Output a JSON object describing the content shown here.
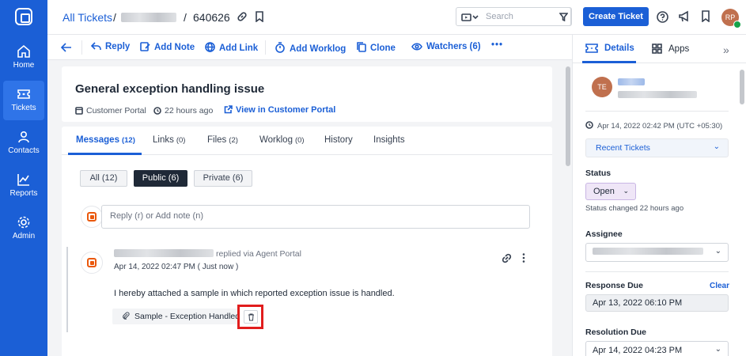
{
  "nav": {
    "items": [
      {
        "label": "Home",
        "icon": "home-icon"
      },
      {
        "label": "Tickets",
        "icon": "ticket-icon",
        "active": true
      },
      {
        "label": "Contacts",
        "icon": "person-icon"
      },
      {
        "label": "Reports",
        "icon": "chart-icon"
      },
      {
        "label": "Admin",
        "icon": "gear-icon"
      }
    ]
  },
  "topbar": {
    "breadcrumb_root": "All Tickets",
    "breadcrumb_sep": "/",
    "ticket_number": "640626",
    "search_placeholder": "Search",
    "create_label": "Create Ticket",
    "user_initials": "RP"
  },
  "actions": {
    "reply": "Reply",
    "add_note": "Add Note",
    "add_link": "Add Link",
    "add_worklog": "Add Worklog",
    "clone": "Clone",
    "watchers": "Watchers (6)",
    "more": "•••"
  },
  "ticket": {
    "title": "General exception handling issue",
    "source": "Customer Portal",
    "age": "22 hours ago",
    "portal_link": "View in Customer Portal"
  },
  "tabs": [
    {
      "label": "Messages",
      "count": "(12)",
      "active": true
    },
    {
      "label": "Links",
      "count": "(0)"
    },
    {
      "label": "Files",
      "count": "(2)"
    },
    {
      "label": "Worklog",
      "count": "(0)"
    },
    {
      "label": "History",
      "count": ""
    },
    {
      "label": "Insights",
      "count": ""
    }
  ],
  "filters": {
    "all": "All (12)",
    "public": "Public (6)",
    "private": "Private (6)"
  },
  "reply_box": {
    "placeholder": "Reply (r) or Add note (n)"
  },
  "message": {
    "via": "replied via Agent Portal",
    "time": "Apr 14, 2022 02:47 PM ( Just now )",
    "body": "I hereby attached a sample in which reported exception issue is handled.",
    "attachment": "Sample - Exception Handled.zip"
  },
  "right_panel": {
    "tab_details": "Details",
    "tab_apps": "Apps",
    "requester_initials": "TE",
    "created_time": "Apr 14, 2022 02:42 PM (UTC +05:30)",
    "recent_tickets": "Recent Tickets",
    "status_label": "Status",
    "status_value": "Open",
    "status_changed": "Status changed 22 hours ago",
    "assignee_label": "Assignee",
    "response_due_label": "Response Due",
    "clear_label": "Clear",
    "response_due_value": "Apr 13, 2022 06:10 PM",
    "resolution_due_label": "Resolution Due",
    "resolution_due_value": "Apr 14, 2022 04:23 PM"
  },
  "colors": {
    "accent": "#1b5fd6",
    "highlight": "#e11d1d",
    "status_bg": "#efe6f7"
  }
}
